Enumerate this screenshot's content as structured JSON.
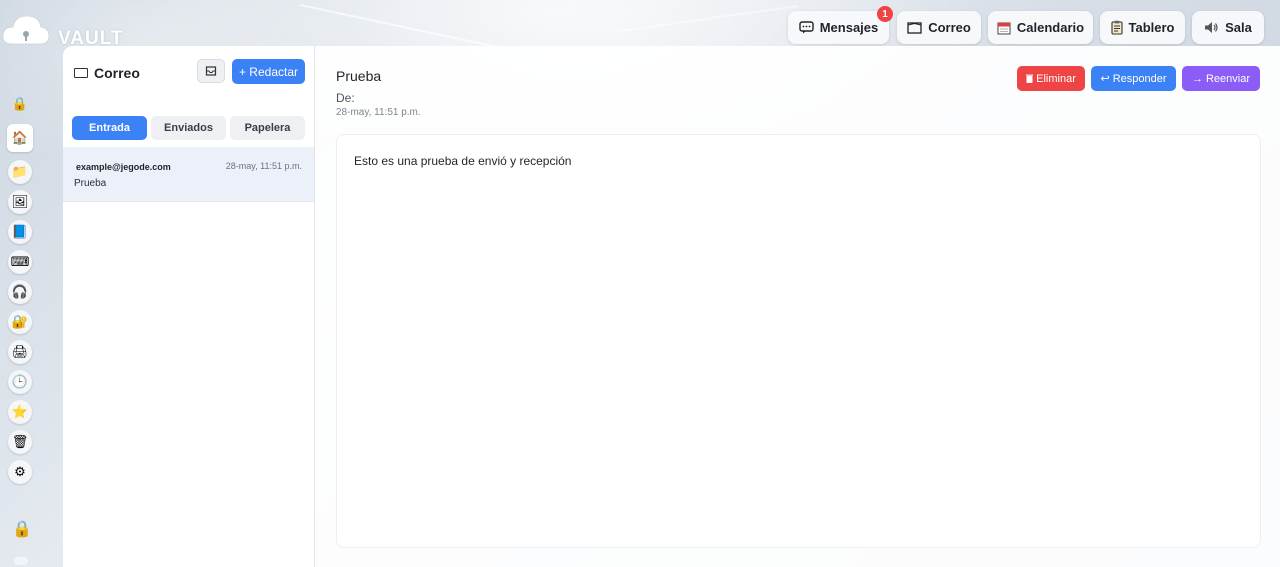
{
  "app": {
    "name": "VAULT"
  },
  "top_nav": [
    {
      "label": "Mensajes",
      "icon": "chat-icon",
      "badge": "1"
    },
    {
      "label": "Correo",
      "icon": "mail-icon"
    },
    {
      "label": "Calendario",
      "icon": "calendar-icon"
    },
    {
      "label": "Tablero",
      "icon": "clipboard-icon"
    },
    {
      "label": "Sala",
      "icon": "speaker-icon"
    }
  ],
  "sidebar": {
    "icons": [
      "lock-icon",
      "home-icon",
      "folder-icon",
      "image-icon",
      "document-icon",
      "keyboard-icon",
      "headphones-icon",
      "padlock-icon",
      "printer-icon",
      "clock-icon",
      "star-icon",
      "trash-icon",
      "settings-icon"
    ],
    "bottom_icon": "lock-icon"
  },
  "mail": {
    "title": "Correo",
    "compose_label": "+ Redactar",
    "tabs": [
      {
        "label": "Entrada",
        "active": true
      },
      {
        "label": "Enviados",
        "active": false
      },
      {
        "label": "Papelera",
        "active": false
      }
    ],
    "items": [
      {
        "from": "example@jegode.com",
        "date": "28-may, 11:51 p.m.",
        "subject": "Prueba"
      }
    ]
  },
  "message": {
    "subject": "Prueba",
    "from_label": "De:",
    "date": "28-may, 11:51 p.m.",
    "body": "Esto es una prueba de envió y recepción",
    "actions": [
      {
        "label": "Eliminar",
        "icon": "trash-icon",
        "color": "#ef4444"
      },
      {
        "label": "Responder",
        "icon": "reply-icon",
        "color": "#3b82f6"
      },
      {
        "label": "Reenviar",
        "icon": "forward-icon",
        "color": "#8b5cf6"
      }
    ]
  }
}
